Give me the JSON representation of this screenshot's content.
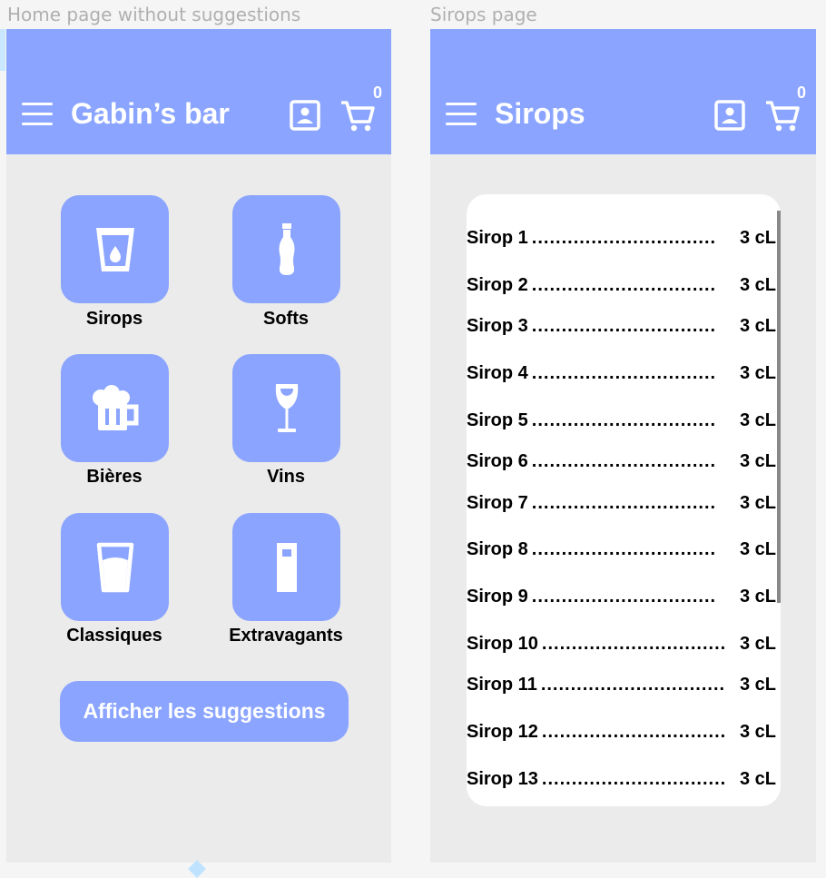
{
  "frames": {
    "home_label": "Home page without suggestions",
    "sirops_label": "Sirops page"
  },
  "home": {
    "title": "Gabin’s bar",
    "cart_count": "0",
    "categories": [
      {
        "label": "Sirops",
        "icon": "glass-drop-icon"
      },
      {
        "label": "Softs",
        "icon": "bottle-icon"
      },
      {
        "label": "Bières",
        "icon": "beer-mug-icon"
      },
      {
        "label": "Vins",
        "icon": "wine-glass-icon"
      },
      {
        "label": "Classiques",
        "icon": "water-glass-icon"
      },
      {
        "label": "Extravagants",
        "icon": "tall-can-icon"
      }
    ],
    "suggest_button": "Afficher les suggestions"
  },
  "sirops": {
    "title": "Sirops",
    "cart_count": "0",
    "dots": "...............................",
    "items": [
      {
        "name": "Sirop 1",
        "qty": "3 cL"
      },
      {
        "name": "Sirop 2",
        "qty": "3 cL"
      },
      {
        "name": "Sirop 3",
        "qty": "3 cL"
      },
      {
        "name": "Sirop 4",
        "qty": "3 cL"
      },
      {
        "name": "Sirop 5",
        "qty": "3 cL"
      },
      {
        "name": "Sirop 6",
        "qty": "3 cL"
      },
      {
        "name": "Sirop 7",
        "qty": "3 cL"
      },
      {
        "name": "Sirop 8",
        "qty": "3 cL"
      },
      {
        "name": "Sirop 9",
        "qty": "3 cL"
      },
      {
        "name": "Sirop 10",
        "qty": "3 cL"
      },
      {
        "name": "Sirop 11",
        "qty": "3 cL"
      },
      {
        "name": "Sirop 12",
        "qty": "3 cL"
      },
      {
        "name": "Sirop 13",
        "qty": "3 cL"
      }
    ]
  },
  "colors": {
    "accent": "#8aa4ff",
    "frame_bg": "#ebebeb"
  }
}
